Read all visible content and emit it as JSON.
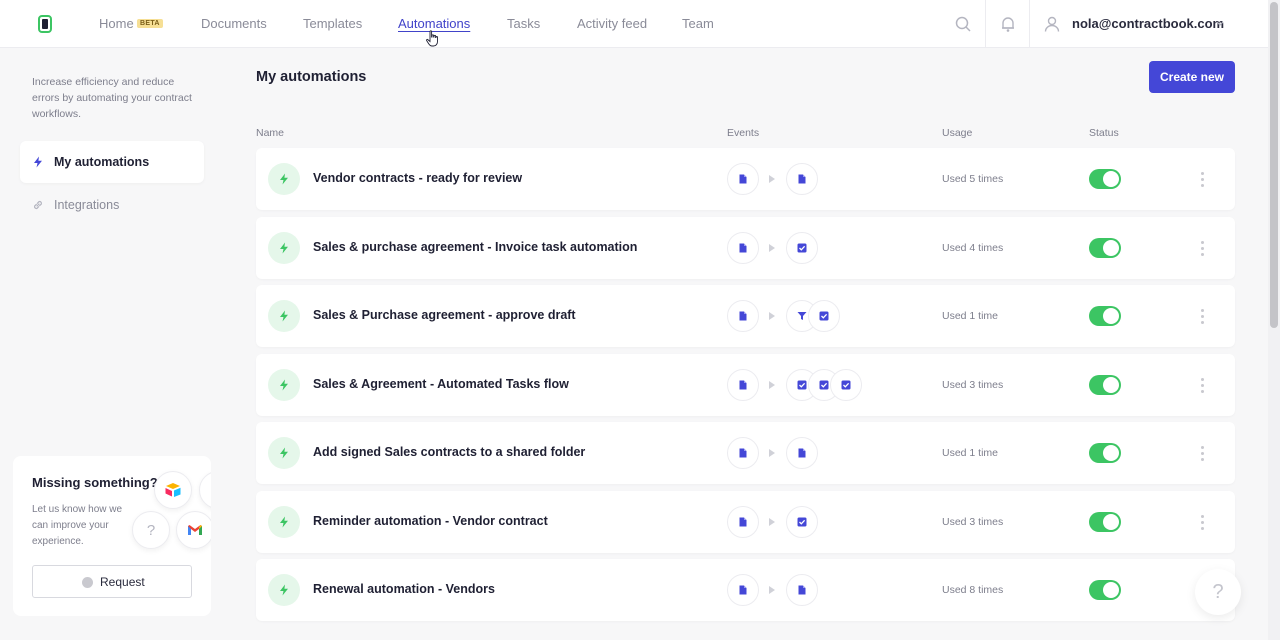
{
  "nav": {
    "items": [
      {
        "label": "Home",
        "active": false
      },
      {
        "label": "Documents",
        "active": false
      },
      {
        "label": "Templates",
        "active": false
      },
      {
        "label": "Automations",
        "active": true
      },
      {
        "label": "Tasks",
        "active": false
      },
      {
        "label": "Activity feed",
        "active": false
      },
      {
        "label": "Team",
        "active": false
      }
    ],
    "home_badge": "BETA",
    "user_email": "nola@contractbook.com",
    "icons": [
      "search-icon",
      "bell-icon",
      "user-icon",
      "chevron-down-icon"
    ]
  },
  "sidebar": {
    "intro": "Increase efficiency and reduce errors by automating your contract workflows.",
    "items": [
      {
        "label": "My automations",
        "icon": "lightning-icon",
        "active": true
      },
      {
        "label": "Integrations",
        "icon": "link-icon",
        "active": false
      }
    ],
    "missing": {
      "title": "Missing something?",
      "text": "Let us know how we can improve your experience.",
      "help_glyph": "?",
      "request_label": "Request"
    }
  },
  "main": {
    "title": "My automations",
    "create_label": "Create new",
    "columns": {
      "name": "Name",
      "events": "Events",
      "usage": "Usage",
      "status": "Status"
    },
    "rows": [
      {
        "name": "Vendor contracts - ready for review",
        "events": [
          "document",
          "document"
        ],
        "usage": "Used 5 times",
        "enabled": true
      },
      {
        "name": "Sales & purchase agreement - Invoice task automation",
        "events": [
          "document",
          "task"
        ],
        "usage": "Used 4 times",
        "enabled": true
      },
      {
        "name": "Sales & Purchase agreement - approve draft",
        "events": [
          "document",
          "filter",
          "task"
        ],
        "usage": "Used 1 time",
        "enabled": true
      },
      {
        "name": "Sales & Agreement - Automated Tasks flow",
        "events": [
          "document",
          "task",
          "task",
          "task"
        ],
        "usage": "Used 3 times",
        "enabled": true
      },
      {
        "name": "Add signed Sales contracts to a shared folder",
        "events": [
          "document",
          "document"
        ],
        "usage": "Used 1 time",
        "enabled": true
      },
      {
        "name": "Reminder automation - Vendor contract",
        "events": [
          "document",
          "task"
        ],
        "usage": "Used 3 times",
        "enabled": true
      },
      {
        "name": "Renewal automation - Vendors",
        "events": [
          "document",
          "document"
        ],
        "usage": "Used 8 times",
        "enabled": true
      }
    ]
  },
  "help_button": "?",
  "colors": {
    "accent": "#4447d7",
    "active_nav": "#4143c9",
    "toggle_on": "#3cc563",
    "lightning": "#3cc563"
  }
}
